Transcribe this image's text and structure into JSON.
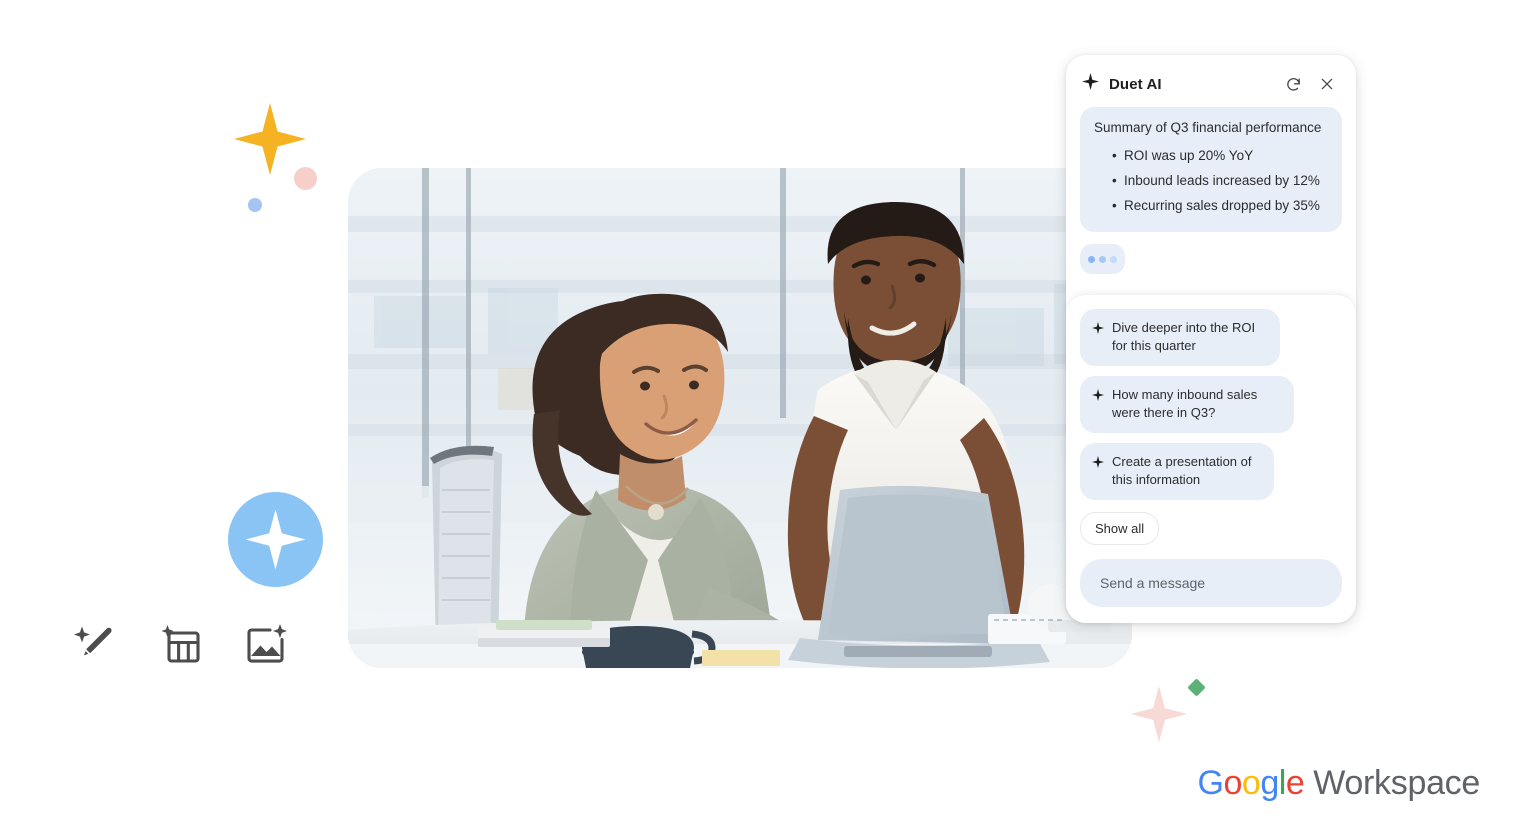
{
  "page": {
    "background": "#ffffff",
    "brand_logo": {
      "google": [
        {
          "ch": "G",
          "color": "#4285F4"
        },
        {
          "ch": "o",
          "color": "#EA4335"
        },
        {
          "ch": "o",
          "color": "#FBBC05"
        },
        {
          "ch": "g",
          "color": "#4285F4"
        },
        {
          "ch": "l",
          "color": "#34A853"
        },
        {
          "ch": "e",
          "color": "#EA4335"
        }
      ],
      "suffix": "Workspace",
      "suffix_color": "#5f6368"
    }
  },
  "decorations": {
    "star_yellow": {
      "name": "four-point-star",
      "color": "#f5b323"
    },
    "dot_pink": {
      "name": "dot",
      "color": "#f7cfc9"
    },
    "dot_blue": {
      "name": "dot",
      "color": "#a6c4f2"
    },
    "badge_blue": {
      "name": "ai-sparkle-badge",
      "color": "#8ac4f5",
      "star_color": "#ffffff"
    },
    "star_pink": {
      "name": "four-point-star",
      "color": "#f7d9d5"
    },
    "diamond_green": {
      "name": "diamond",
      "color": "#5cb275"
    }
  },
  "tool_icons": [
    {
      "name": "magic-write-icon",
      "label": "Help me write"
    },
    {
      "name": "magic-table-icon",
      "label": "Help me organize"
    },
    {
      "name": "magic-image-icon",
      "label": "Help me visualize"
    }
  ],
  "hero_photo": {
    "name": "office-collaboration-photo",
    "alt": "Two colleagues smiling while looking at a laptop in a bright office"
  },
  "duet_panel": {
    "title": "Duet AI",
    "sparkle_icon": "sparkle-icon",
    "refresh_icon": "refresh-icon",
    "close_icon": "close-icon",
    "message": {
      "heading": "Summary of Q3 financial performance",
      "bullets": [
        "ROI was up 20% YoY",
        "Inbound leads increased by 12%",
        "Recurring sales dropped by 35%"
      ]
    },
    "typing_indicator": {
      "name": "typing-indicator",
      "dot_colors": [
        "#8ab4f8",
        "#a6c8fa",
        "#c3dafc"
      ]
    },
    "suggestions": [
      "Dive deeper into the ROI for this quarter",
      "How many inbound sales were there in Q3?",
      "Create a presentation of this information"
    ],
    "show_all_label": "Show all",
    "composer": {
      "placeholder": "Send a message",
      "value": ""
    }
  }
}
